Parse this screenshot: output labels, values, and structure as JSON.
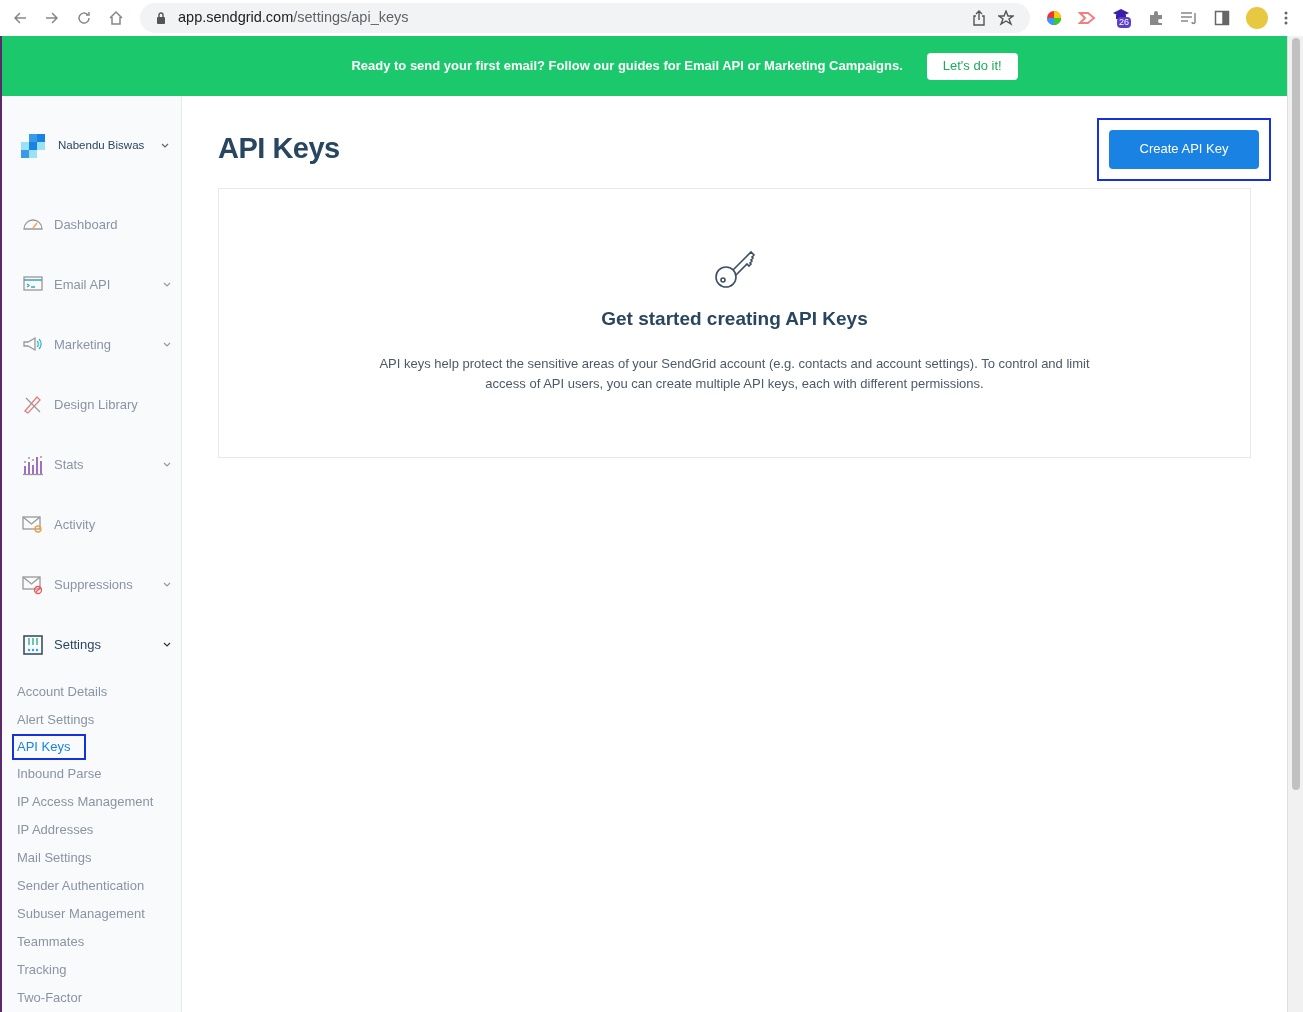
{
  "browser": {
    "url_host": "app.sendgrid.com",
    "url_path": "/settings/api_keys",
    "extension_badge": "26"
  },
  "banner": {
    "message": "Ready to send your first email? Follow our guides for Email API or Marketing Campaigns.",
    "button": "Let's do it!"
  },
  "account": {
    "name": "Nabendu Biswas"
  },
  "nav": [
    {
      "label": "Dashboard",
      "has_submenu": false,
      "expanded": false
    },
    {
      "label": "Email API",
      "has_submenu": true,
      "expanded": false
    },
    {
      "label": "Marketing",
      "has_submenu": true,
      "expanded": false
    },
    {
      "label": "Design Library",
      "has_submenu": false,
      "expanded": false
    },
    {
      "label": "Stats",
      "has_submenu": true,
      "expanded": false
    },
    {
      "label": "Activity",
      "has_submenu": false,
      "expanded": false
    },
    {
      "label": "Suppressions",
      "has_submenu": true,
      "expanded": false
    },
    {
      "label": "Settings",
      "has_submenu": true,
      "expanded": true,
      "children": [
        {
          "label": "Account Details",
          "selected": false,
          "highlighted": false
        },
        {
          "label": "Alert Settings",
          "selected": false,
          "highlighted": false
        },
        {
          "label": "API Keys",
          "selected": true,
          "highlighted": true
        },
        {
          "label": "Inbound Parse",
          "selected": false,
          "highlighted": false
        },
        {
          "label": "IP Access Management",
          "selected": false,
          "highlighted": false
        },
        {
          "label": "IP Addresses",
          "selected": false,
          "highlighted": false
        },
        {
          "label": "Mail Settings",
          "selected": false,
          "highlighted": false
        },
        {
          "label": "Sender Authentication",
          "selected": false,
          "highlighted": false
        },
        {
          "label": "Subuser Management",
          "selected": false,
          "highlighted": false
        },
        {
          "label": "Teammates",
          "selected": false,
          "highlighted": false
        },
        {
          "label": "Tracking",
          "selected": false,
          "highlighted": false
        },
        {
          "label": "Two-Factor",
          "selected": false,
          "highlighted": false
        }
      ]
    }
  ],
  "page": {
    "title": "API Keys",
    "create_button": "Create API Key",
    "create_button_highlighted": true
  },
  "empty_state": {
    "heading": "Get started creating API Keys",
    "description": "API keys help protect the sensitive areas of your SendGrid account (e.g. contacts and account settings). To control and limit access of API users, you can create multiple API keys, each with different permissions."
  }
}
